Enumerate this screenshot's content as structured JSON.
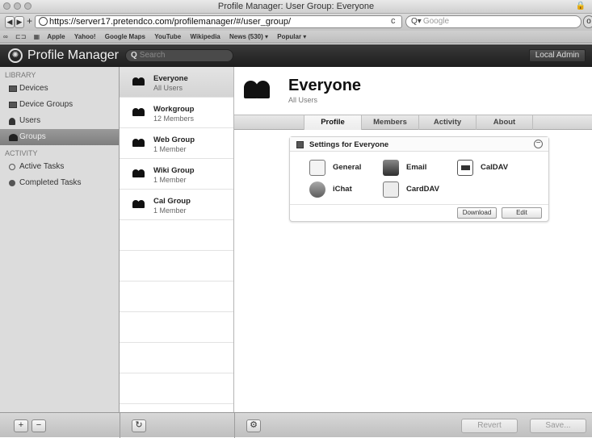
{
  "browser": {
    "window_title": "Profile Manager: User Group: Everyone",
    "url_scheme": "https://",
    "url_rest": "server17.pretendco.com/profilemanager/#/user_group/",
    "search_placeholder": "Google",
    "bookmarks": [
      "Apple",
      "Yahoo!",
      "Google Maps",
      "YouTube",
      "Wikipedia",
      "News (530) ▾",
      "Popular ▾"
    ]
  },
  "app": {
    "name": "Profile Manager",
    "search_placeholder": "Search",
    "admin_label": "Local Admin"
  },
  "sidebar": {
    "library_heading": "LIBRARY",
    "library_items": [
      "Devices",
      "Device Groups",
      "Users",
      "Groups"
    ],
    "activity_heading": "ACTIVITY",
    "activity_items": [
      "Active Tasks",
      "Completed Tasks"
    ]
  },
  "groups": [
    {
      "name": "Everyone",
      "sub": "All Users"
    },
    {
      "name": "Workgroup",
      "sub": "12 Members"
    },
    {
      "name": "Web Group",
      "sub": "1 Member"
    },
    {
      "name": "Wiki Group",
      "sub": "1 Member"
    },
    {
      "name": "Cal Group",
      "sub": "1 Member"
    }
  ],
  "detail": {
    "title": "Everyone",
    "subtitle": "All Users",
    "tabs": [
      "Profile",
      "Members",
      "Activity",
      "About"
    ],
    "settings_title": "Settings for Everyone",
    "payloads": [
      "General",
      "Email",
      "CalDAV",
      "iChat",
      "CardDAV"
    ],
    "download_label": "Download",
    "edit_label": "Edit"
  },
  "footer": {
    "add_glyph": "+",
    "remove_glyph": "−",
    "refresh_glyph": "↻",
    "gear_glyph": "⚙",
    "revert_label": "Revert",
    "save_label": "Save..."
  }
}
